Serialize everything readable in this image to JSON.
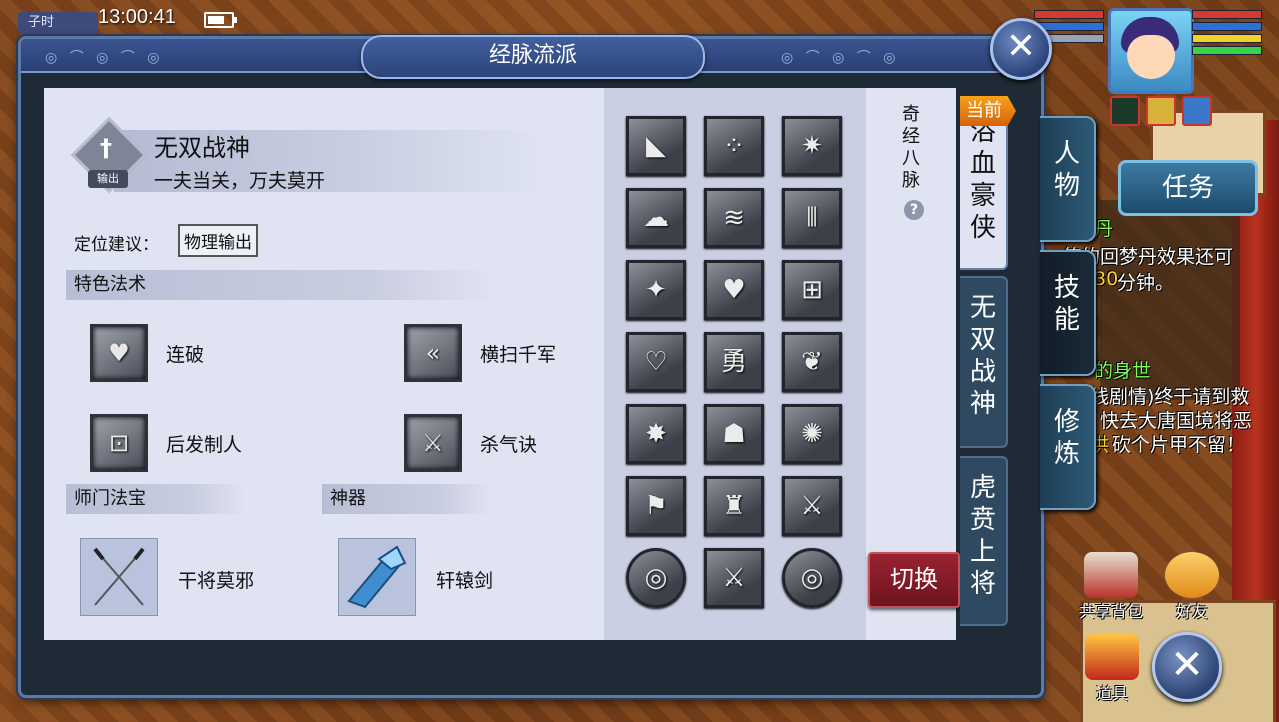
{
  "status": {
    "clock_tag": "子时",
    "time": "13:00:41"
  },
  "window": {
    "title": "经脉流派",
    "close_label": "✕"
  },
  "school": {
    "name": "无双战神",
    "motto": "一夫当关，万夫莫开",
    "emblem_tag": "输出",
    "role_label": "定位建议：",
    "role_value": "物理输出"
  },
  "special_skills": {
    "header": "特色法术",
    "items": [
      {
        "name": "连破",
        "icon": "heart-figure-icon"
      },
      {
        "name": "横扫千军",
        "icon": "triple-arrow-icon"
      },
      {
        "name": "后发制人",
        "icon": "gate-rune-icon"
      },
      {
        "name": "杀气诀",
        "icon": "sword-slash-icon"
      }
    ]
  },
  "treasure": {
    "header": "师门法宝",
    "name": "干将莫邪",
    "icon": "crossed-swords-icon"
  },
  "artifact": {
    "header": "神器",
    "name": "轩辕剑",
    "icon": "crystal-sword-icon"
  },
  "meridian": {
    "title": "奇经八脉",
    "help": "?",
    "switch_label": "切换"
  },
  "school_tabs": {
    "current_badge": "当前",
    "items": [
      {
        "label": "浴血豪侠",
        "active": true
      },
      {
        "label": "无双战神",
        "active": false
      },
      {
        "label": "虎贲上将",
        "active": false
      }
    ]
  },
  "side_menu": {
    "items": [
      {
        "label": "人物"
      },
      {
        "label": "技能"
      },
      {
        "label": "修炼"
      }
    ],
    "quest_label": "任务"
  },
  "corner_buttons": {
    "shared_bag": "共享背包",
    "friends": "好友",
    "items": "道具",
    "close": "✕"
  },
  "background_text": {
    "line1": "丹",
    "line2": "使的回梦丹效果还可",
    "line3a": "30",
    "line3b": "分钟。",
    "line4": "的身世",
    "line5": "线剧情)终于请到救",
    "line6": "快去大唐国境将恶",
    "line7a": "洪",
    "line7b": "砍个片甲不留！"
  },
  "grid_icons": [
    "cannon-icon",
    "node-network-icon",
    "winged-demon-icon",
    "storm-cloud-icon",
    "wave-spiral-icon",
    "bamboo-icon",
    "flame-warrior-icon",
    "heart-hands-icon",
    "maze-icon",
    "heart-sword-icon",
    "brave-badge-icon",
    "vine-icon",
    "explosion-icon",
    "monk-icon",
    "spider-icon",
    "wind-figure-icon",
    "general-icon",
    "sword-strike-icon",
    "swirl-orb-icon",
    "twin-blades-icon",
    "swirl-orb-icon"
  ],
  "grid_glyphs": [
    "◣",
    "⁘",
    "✷",
    "☁",
    "≋",
    "⫴",
    "✦",
    "♥",
    "⊞",
    "♡",
    "勇",
    "❦",
    "✸",
    "☗",
    "✺",
    "⚑",
    "♜",
    "⚔",
    "◎",
    "⚔",
    "◎"
  ]
}
